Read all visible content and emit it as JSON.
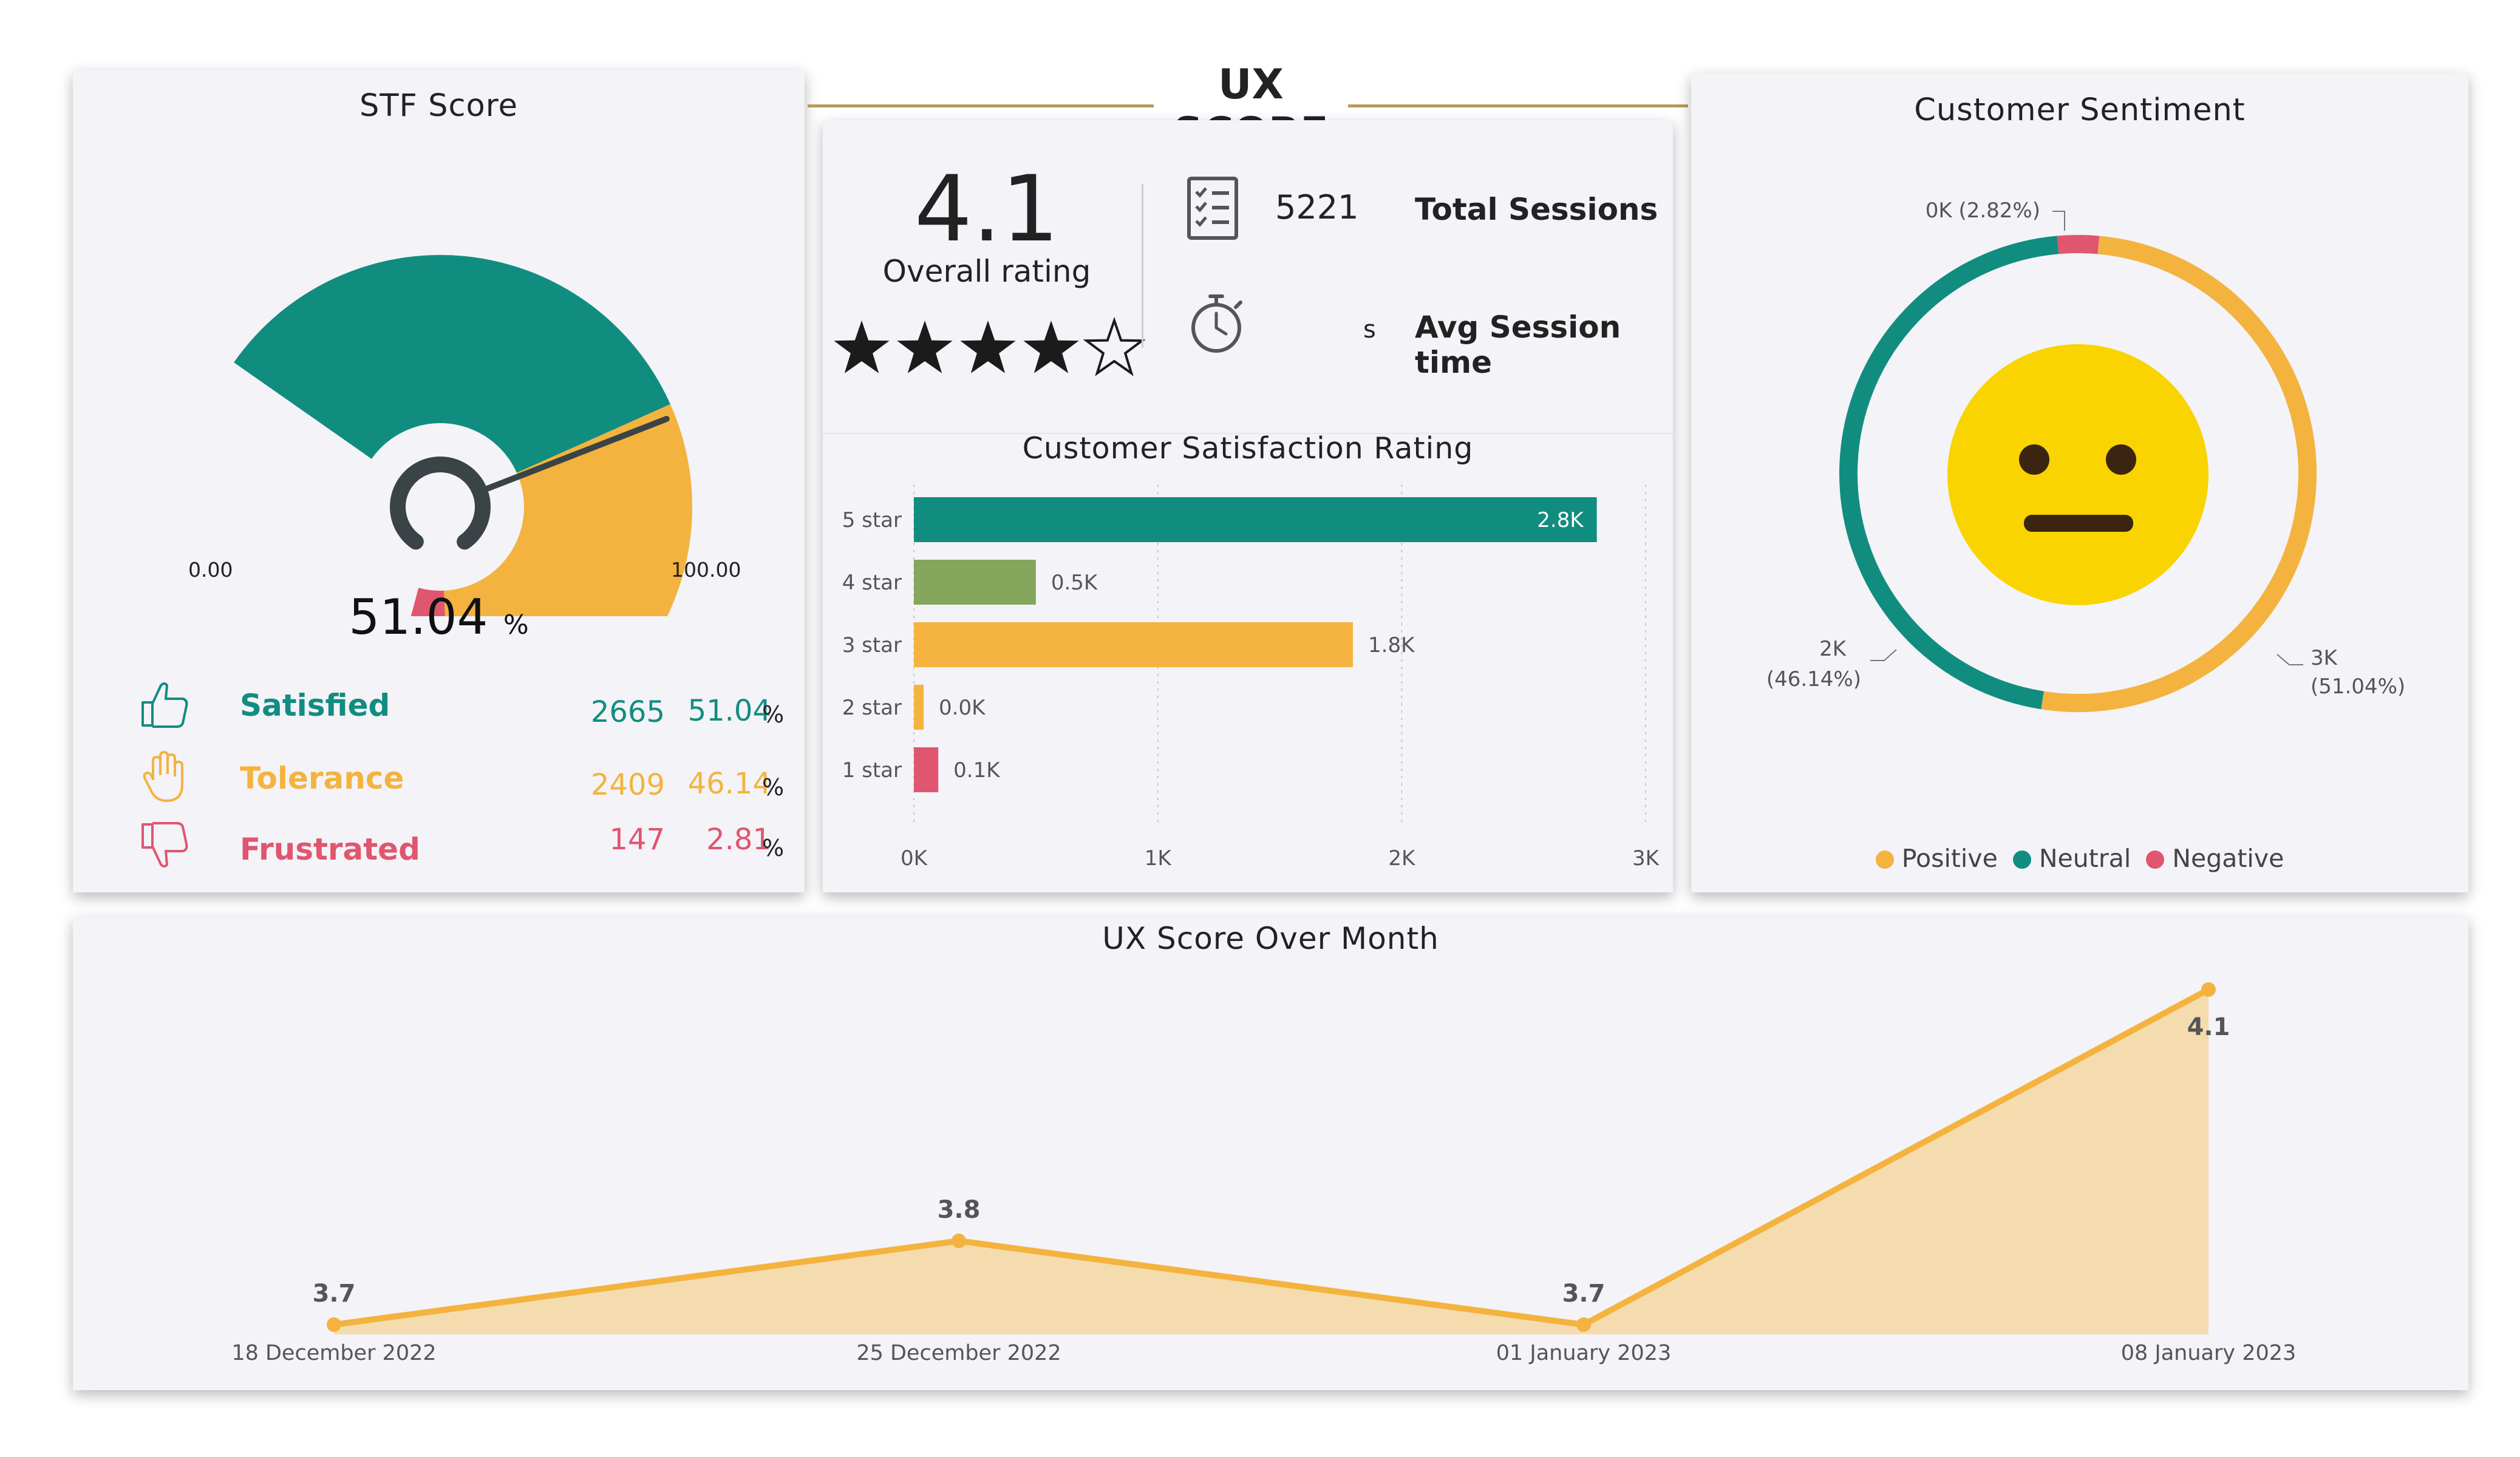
{
  "header": {
    "title": "UX SCORE"
  },
  "stf_score": {
    "title": "STF Score",
    "gauge_min": "0.00",
    "gauge_max": "100.00",
    "value": "51.04",
    "unit": "%",
    "rows": [
      {
        "label": "Satisfied",
        "count": "2665",
        "percent": "51.04",
        "unit": "%",
        "icon": "thumbs-up-icon",
        "color": "#118d80"
      },
      {
        "label": "Tolerance",
        "count": "2409",
        "percent": "46.14",
        "unit": "%",
        "icon": "raised-hand-icon",
        "color": "#f4b33e"
      },
      {
        "label": "Frustrated",
        "count": "147",
        "percent": "2.81",
        "unit": "%",
        "icon": "thumbs-down-icon",
        "color": "#e0566f"
      }
    ],
    "gauge_fill_percent": 51.04
  },
  "overall": {
    "rating": "4.1",
    "rating_label": "Overall rating",
    "stars_filled": 4,
    "stars_total": 5,
    "total_sessions_value": "5221",
    "total_sessions_label": "Total Sessions",
    "avg_session_unit": "s",
    "avg_session_label": "Avg Session time"
  },
  "colors": {
    "teal": "#118d80",
    "yellow": "#f4b33e",
    "red": "#e0566f",
    "olive": "#84a65d",
    "area_fill": "#f5dcae"
  },
  "satisfaction_chart": {
    "chart_data": {
      "type": "bar",
      "title": "Customer Satisfaction Rating",
      "categories": [
        "5 star",
        "4 star",
        "3 star",
        "2 star",
        "1 star"
      ],
      "values": [
        2.8,
        0.5,
        1.8,
        0.0,
        0.1
      ],
      "value_labels": [
        "2.8K",
        "0.5K",
        "1.8K",
        "0.0K",
        "0.1K"
      ],
      "bar_colors": [
        "#118d80",
        "#84a65d",
        "#f4b33e",
        "#f4b33e",
        "#e0566f"
      ],
      "x_ticks": [
        "0K",
        "1K",
        "2K",
        "3K"
      ],
      "xlim": [
        0,
        3
      ],
      "grid": true
    }
  },
  "sentiment": {
    "title": "Customer Sentiment",
    "chart_data": {
      "type": "pie",
      "slices": [
        {
          "name": "Positive",
          "value": 51.04,
          "label": "3K",
          "pct_label": "(51.04%)",
          "color": "#f4b33e"
        },
        {
          "name": "Neutral",
          "value": 46.14,
          "label": "2K",
          "pct_label": "(46.14%)",
          "color": "#118d80"
        },
        {
          "name": "Negative",
          "value": 2.82,
          "label": "0K (2.82%)",
          "pct_label": "",
          "color": "#e0566f"
        }
      ],
      "legend": [
        "Positive",
        "Neutral",
        "Negative"
      ],
      "legend_placement": "bottom"
    },
    "center_icon": "neutral-face-icon"
  },
  "ux_over_month": {
    "chart_data": {
      "type": "area",
      "title": "UX Score Over Month",
      "x": [
        "18 December 2022",
        "25 December 2022",
        "01 January 2023",
        "08 January 2023"
      ],
      "values": [
        3.7,
        3.8,
        3.7,
        4.1
      ],
      "value_labels": [
        "3.7",
        "3.8",
        "3.7",
        "4.1"
      ],
      "color": "#f4b33e",
      "grid": false
    }
  }
}
